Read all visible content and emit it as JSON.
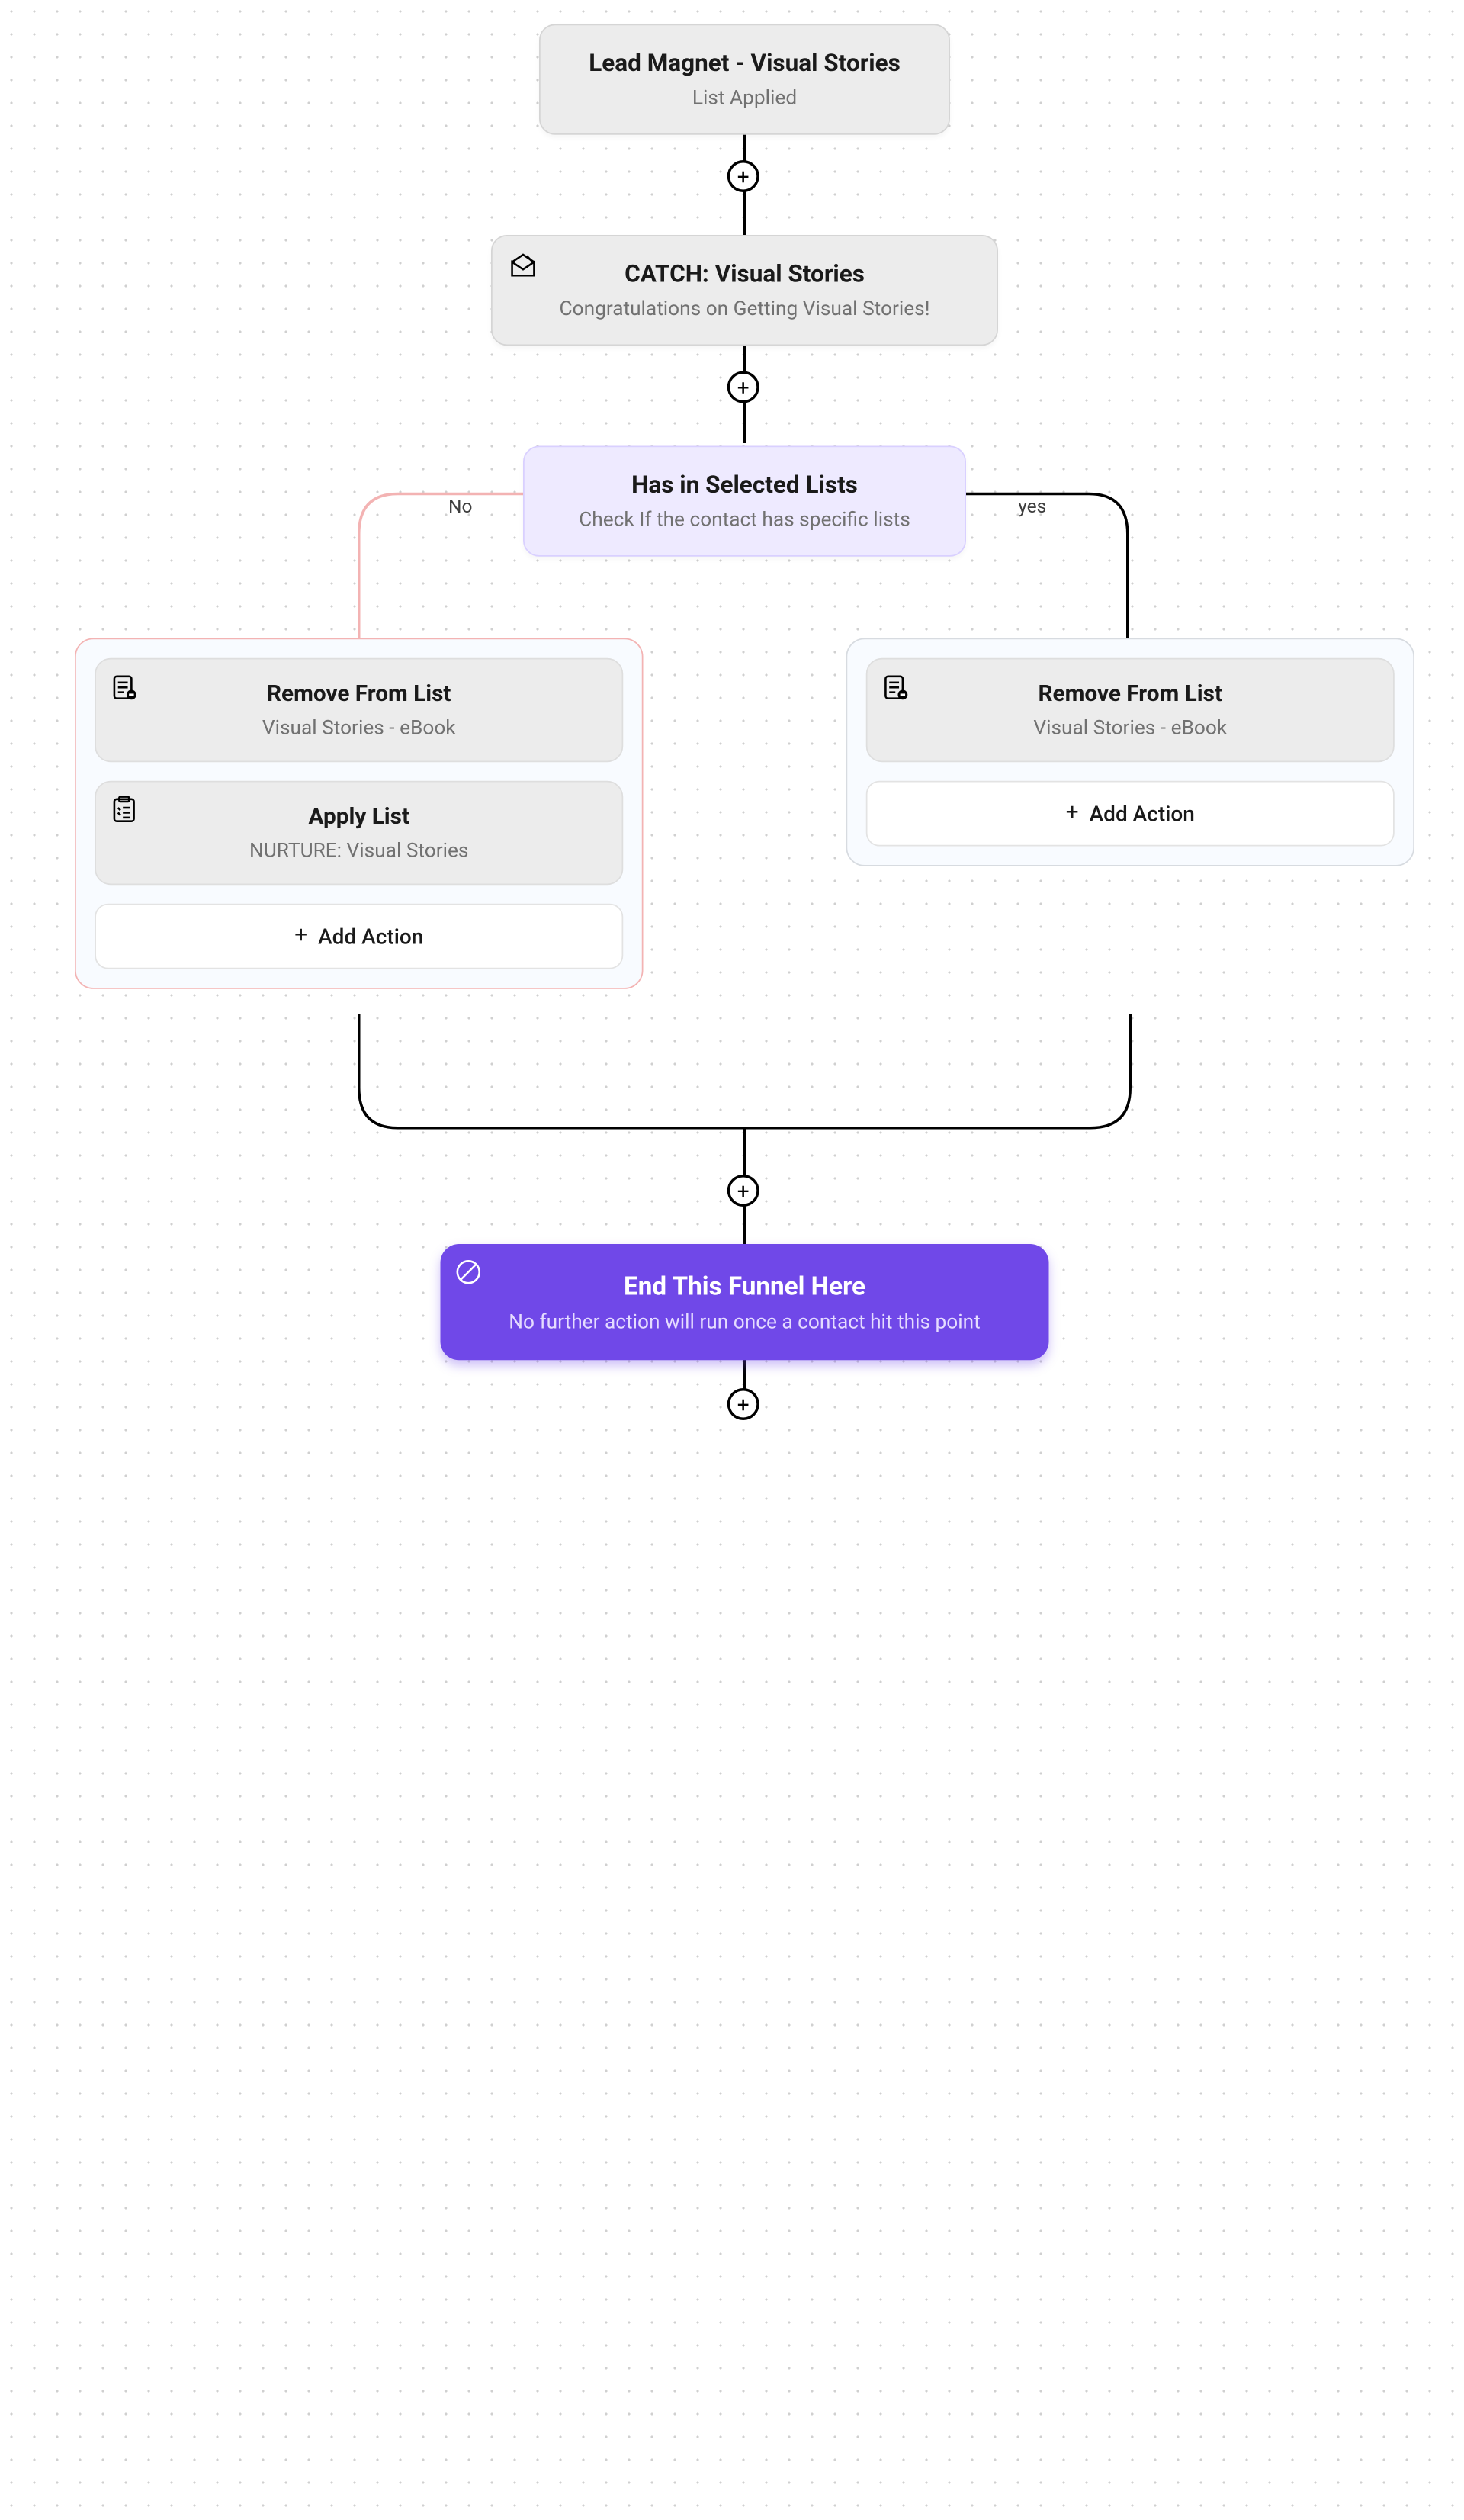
{
  "start": {
    "title": "Lead Magnet - Visual Stories",
    "subtitle": "List Applied"
  },
  "catch": {
    "title": "CATCH: Visual Stories",
    "subtitle": "Congratulations on Getting Visual Stories!"
  },
  "condition": {
    "title": "Has in Selected Lists",
    "subtitle": "Check If the contact has specific lists",
    "no_label": "No",
    "yes_label": "yes"
  },
  "no_branch": {
    "actions": [
      {
        "title": "Remove From List",
        "subtitle": "Visual Stories - eBook"
      },
      {
        "title": "Apply List",
        "subtitle": "NURTURE: Visual Stories"
      }
    ],
    "add_label": "Add Action"
  },
  "yes_branch": {
    "actions": [
      {
        "title": "Remove From List",
        "subtitle": "Visual Stories - eBook"
      }
    ],
    "add_label": "Add Action"
  },
  "end": {
    "title": "End This Funnel Here",
    "subtitle": "No further action will run once a contact hit this point"
  }
}
